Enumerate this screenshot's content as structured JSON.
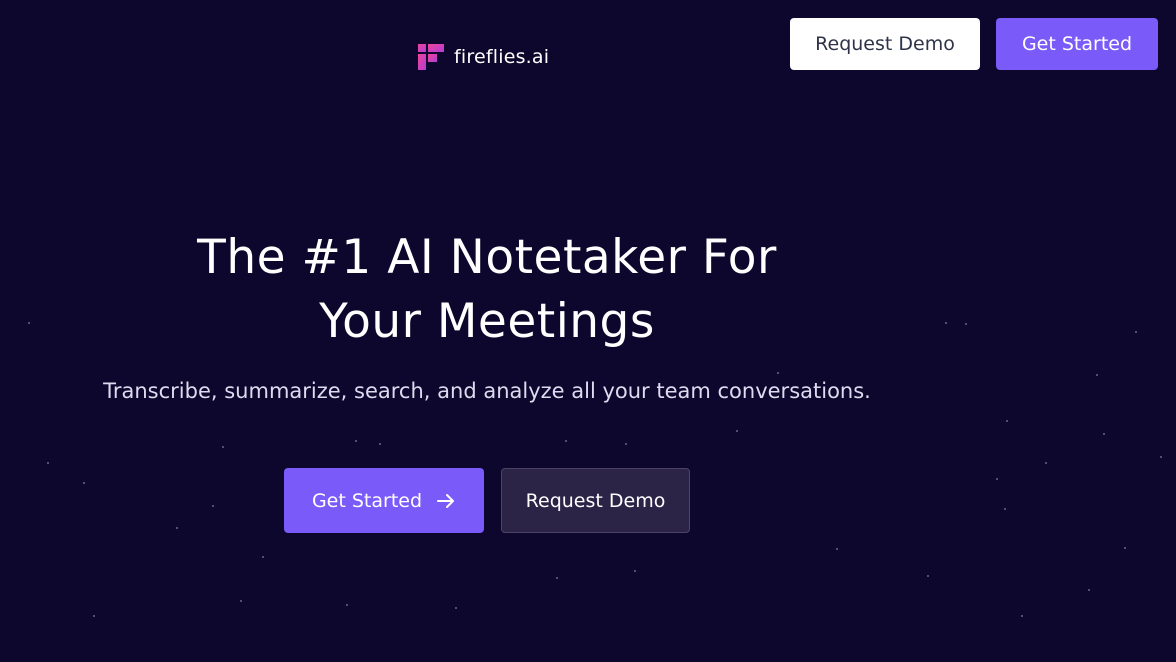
{
  "brand": {
    "name": "fireflies.ai",
    "logo_icon": "fireflies-logo-icon",
    "colors": {
      "logo_primary": "#e83e8c",
      "logo_secondary": "#7a5af8"
    }
  },
  "nav": {
    "request_demo_label": "Request Demo",
    "get_started_label": "Get Started"
  },
  "hero": {
    "headline_line1": "The #1 AI Notetaker For",
    "headline_line2": "Your Meetings",
    "subheadline": "Transcribe, summarize, search, and analyze all your team conversations.",
    "primary_cta_label": "Get Started",
    "primary_cta_icon": "arrow-right-icon",
    "secondary_cta_label": "Request Demo"
  },
  "colors": {
    "background": "#0e072d",
    "accent": "#7a5af8",
    "secondary_button": "#2b2447"
  }
}
